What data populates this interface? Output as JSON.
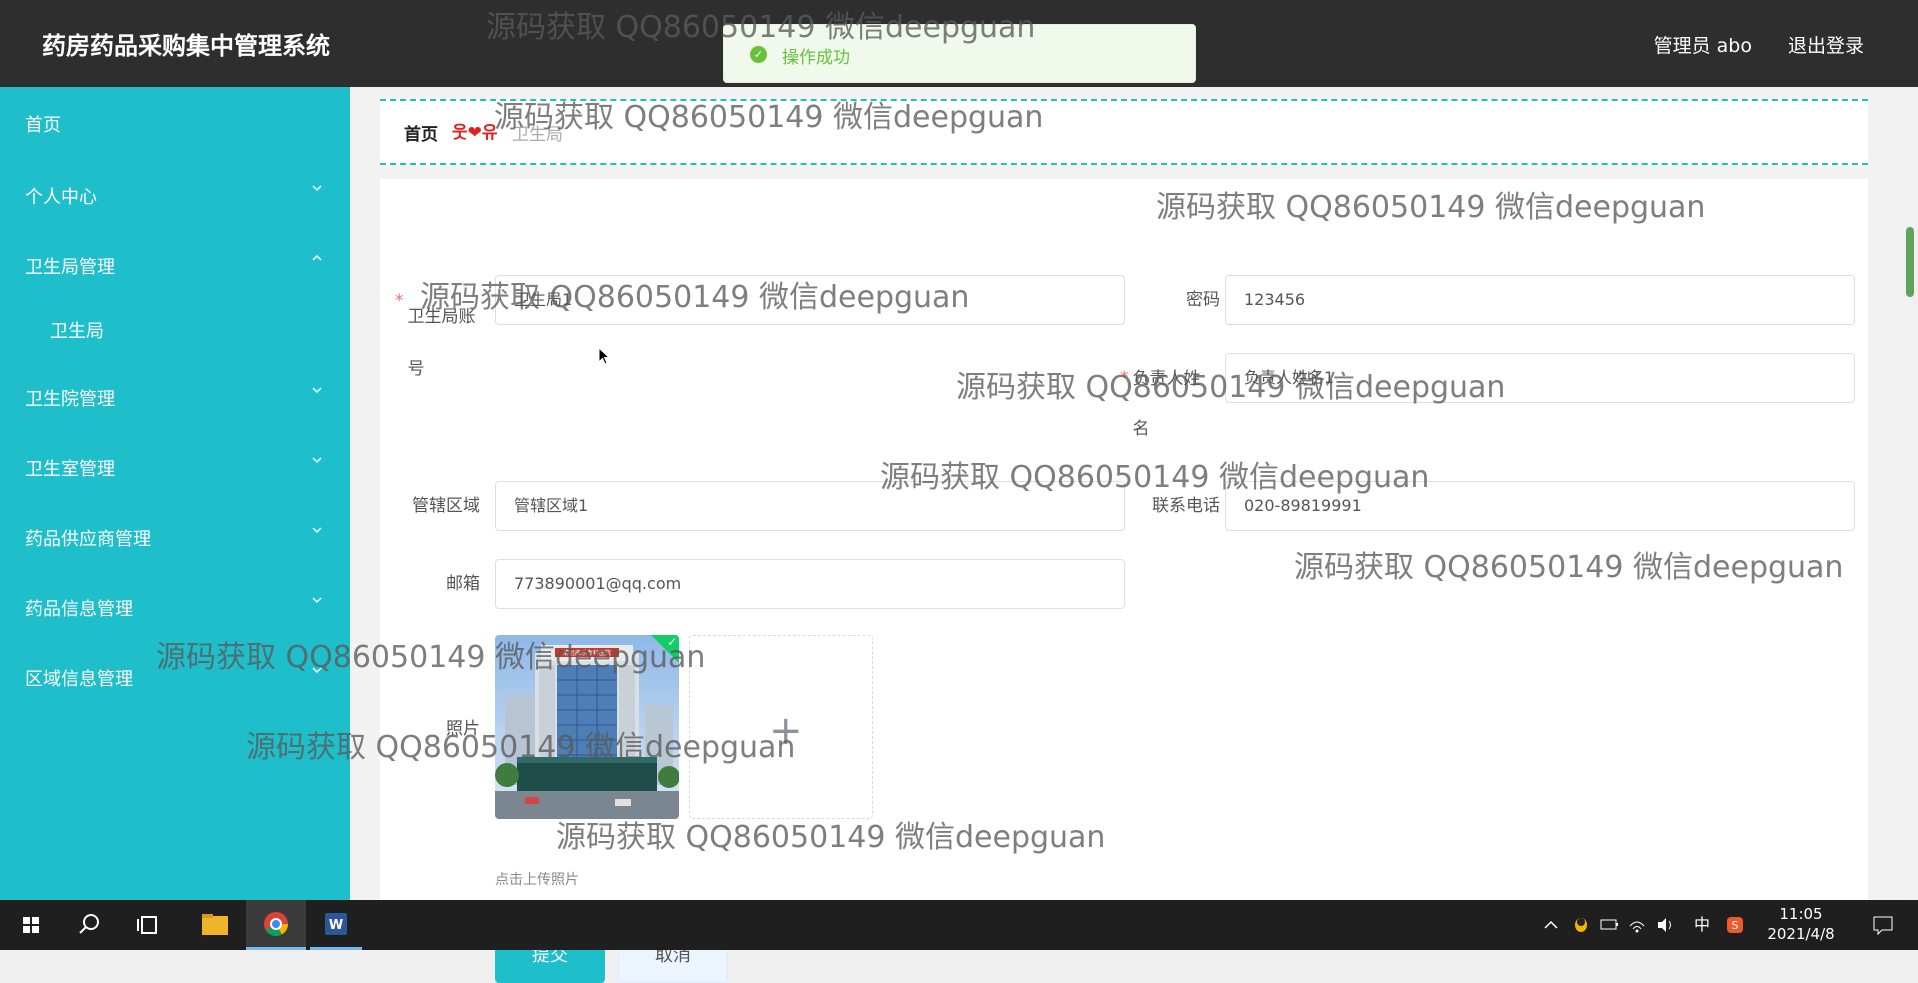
{
  "header": {
    "title": "药房药品采购集中管理系统",
    "user": "管理员 abo",
    "logout": "退出登录"
  },
  "toast": {
    "message": "操作成功"
  },
  "sidebar": {
    "items": [
      {
        "label": "首页"
      },
      {
        "label": "个人中心"
      },
      {
        "label": "卫生局管理"
      },
      {
        "label": "卫生局"
      },
      {
        "label": "卫生院管理"
      },
      {
        "label": "卫生室管理"
      },
      {
        "label": "药品供应商管理"
      },
      {
        "label": "药品信息管理"
      },
      {
        "label": "区域信息管理"
      }
    ]
  },
  "breadcrumb": {
    "home": "首页",
    "separator": "웃❤유",
    "current": "卫生局"
  },
  "form": {
    "account_label": "卫生局账号",
    "account_value": "卫生局1",
    "password_label": "密码",
    "password_value": "123456",
    "manager_label": "负责人姓名",
    "manager_value": "负责人姓名1",
    "region_label": "管辖区域",
    "region_value": "管辖区域1",
    "phone_label": "联系电话",
    "phone_value": "020-89819991",
    "email_label": "邮箱",
    "email_value": "773890001@qq.com",
    "photo_label": "照片",
    "photo_banner": "清远康乐专科医院",
    "upload_hint": "点击上传照片",
    "submit": "提交",
    "cancel": "取消"
  },
  "watermark": "源码获取 QQ86050149 微信deepguan",
  "taskbar": {
    "ime": "中",
    "time": "11:05",
    "date": "2021/4/8"
  },
  "colors": {
    "accent": "#1fbecb",
    "header": "#2e2e2e",
    "success": "#67c23a",
    "required": "#f56c6c"
  }
}
